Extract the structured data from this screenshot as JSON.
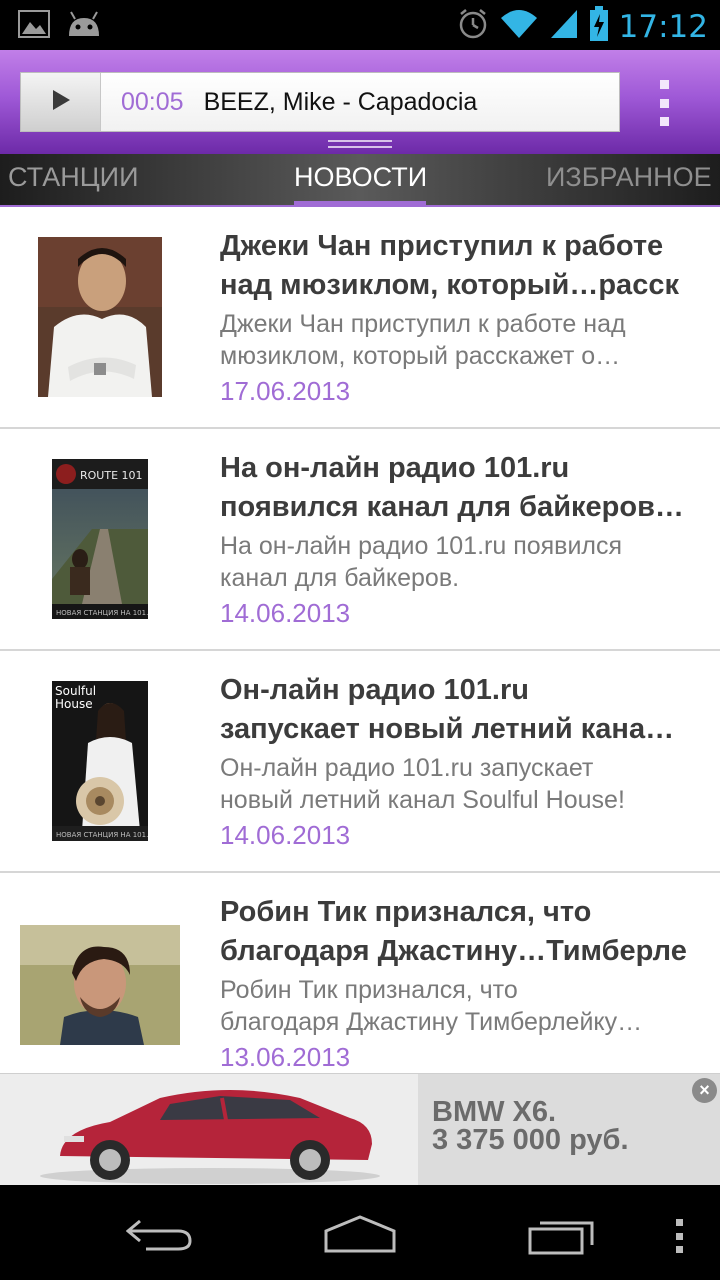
{
  "status_bar": {
    "time": "17:12",
    "left_icons": [
      "picture-icon",
      "android-icon"
    ],
    "right_icons": [
      "alarm-icon",
      "wifi-icon",
      "signal-icon",
      "battery-charging-icon"
    ]
  },
  "player": {
    "elapsed": "00:05",
    "track": "BEEZ, Mike - Capadocia",
    "play_icon": "play-icon",
    "menu_icon": "overflow-menu-icon"
  },
  "tabs": [
    {
      "label": "СТАНЦИИ",
      "selected": false
    },
    {
      "label": "НОВОСТИ",
      "selected": true
    },
    {
      "label": "ИЗБРАННОЕ",
      "selected": false
    }
  ],
  "news": [
    {
      "headline_line1": "Джеки Чан приступил к работе",
      "headline_line2": "над мюзиклом, который…расск",
      "summary_line1": "Джеки Чан приступил к работе над",
      "summary_line2": "мюзиклом, который расскажет о…",
      "date": "17.06.2013"
    },
    {
      "headline_line1": "На он-лайн радио 101.ru",
      "headline_line2": "появился канал для байкеров…",
      "summary_line1": "На он-лайн радио 101.ru появился",
      "summary_line2": "канал для байкеров.",
      "date": "14.06.2013",
      "thumb_text": "ROUTE 101",
      "thumb_caption": "НОВАЯ СТАНЦИЯ НА 101.RU"
    },
    {
      "headline_line1": "Он-лайн радио 101.ru",
      "headline_line2": "запускает новый летний кана…",
      "summary_line1": "Он-лайн радио 101.ru запускает",
      "summary_line2": "новый летний канал Soulful House!",
      "date": "14.06.2013",
      "thumb_text_1": "Soulful",
      "thumb_text_2": "House",
      "thumb_caption": "НОВАЯ СТАНЦИЯ НА 101.RU"
    },
    {
      "headline_line1": "Робин Тик признался, что",
      "headline_line2": "благодаря Джастину…Тимберле",
      "summary_line1": "Робин Тик признался, что",
      "summary_line2": "благодаря Джастину Тимберлейку…",
      "date": "13.06.2013"
    }
  ],
  "ad": {
    "model": "BMW X6.",
    "price": "3 375 000 руб.",
    "close_icon": "close-icon"
  },
  "nav_bar": {
    "icons": [
      "back-icon",
      "home-icon",
      "recent-apps-icon",
      "menu-icon"
    ]
  },
  "colors": {
    "accent": "#a06cd5",
    "status_time": "#33b5e5",
    "player_top": "#c17fe8",
    "player_bottom": "#6d2aa8"
  }
}
